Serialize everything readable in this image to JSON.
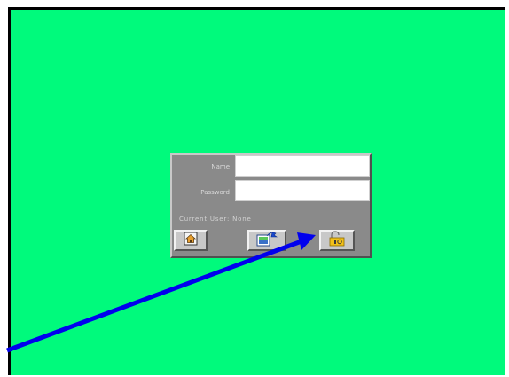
{
  "login": {
    "name_label": "Name",
    "password_label": "Password",
    "current_user_text": "Current User: None",
    "name_value": "",
    "password_value": ""
  },
  "buttons": [
    {
      "icon": "home-icon"
    },
    {
      "icon": "logout-icon"
    },
    {
      "icon": "login-lock-icon"
    }
  ],
  "colors": {
    "screen_bg": "#00fa7c",
    "panel_bg": "#8a8a8a",
    "arrow": "#0000ee"
  }
}
